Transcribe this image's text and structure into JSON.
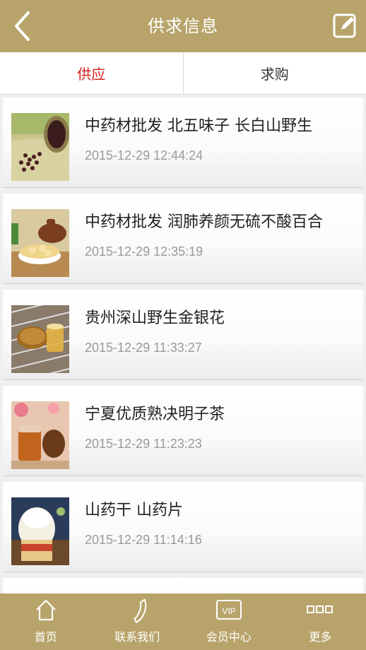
{
  "header": {
    "title": "供求信息",
    "back_icon": "back-arrow-icon",
    "edit_icon": "edit-icon"
  },
  "tabs": [
    {
      "label": "供应",
      "active": true
    },
    {
      "label": "求购",
      "active": false
    }
  ],
  "items": [
    {
      "title": "中药材批发 北五味子 长白山野生",
      "time": "2015-12-29 12:44:24"
    },
    {
      "title": "中药材批发 润肺养颜无硫不酸百合",
      "time": "2015-12-29 12:35:19"
    },
    {
      "title": "贵州深山野生金银花",
      "time": "2015-12-29 11:33:27"
    },
    {
      "title": "宁夏优质熟决明子茶",
      "time": "2015-12-29 11:23:23"
    },
    {
      "title": "山药干 山药片",
      "time": "2015-12-29 11:14:16"
    }
  ],
  "bottom_nav": [
    {
      "label": "首页",
      "icon": "home-icon"
    },
    {
      "label": "联系我们",
      "icon": "phone-icon"
    },
    {
      "label": "会员中心",
      "icon": "vip-icon",
      "icon_text": "VIP"
    },
    {
      "label": "更多",
      "icon": "more-icon"
    }
  ],
  "colors": {
    "brand": "#b8a46b",
    "active_tab": "#d62020",
    "time_text": "#9a9a9a"
  }
}
